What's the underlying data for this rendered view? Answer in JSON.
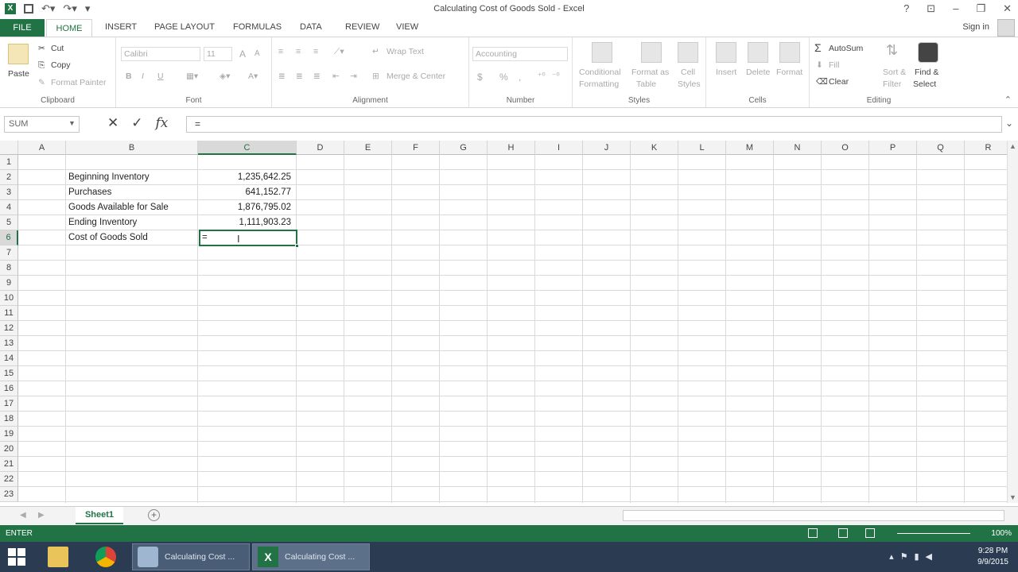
{
  "window": {
    "title": "Calculating Cost of Goods Sold - Excel",
    "signin": "Sign in",
    "qat": [
      "excel-logo-icon",
      "save-icon",
      "undo-icon",
      "redo-icon",
      "customize-icon"
    ],
    "controls": [
      "?",
      "restore",
      "minimize",
      "maximize",
      "close"
    ]
  },
  "ribbon_tabs": [
    "FILE",
    "HOME",
    "INSERT",
    "PAGE LAYOUT",
    "FORMULAS",
    "DATA",
    "REVIEW",
    "VIEW"
  ],
  "ribbon": {
    "clipboard": {
      "label": "Clipboard",
      "paste": "Paste",
      "cut": "Cut",
      "copy": "Copy",
      "format_painter": "Format Painter"
    },
    "font": {
      "label": "Font",
      "font_name": "Calibri",
      "font_size": "11",
      "bold": "B",
      "italic": "I",
      "underline": "U",
      "grow": "A",
      "shrink": "A"
    },
    "alignment": {
      "label": "Alignment",
      "wrap_text": "Wrap Text",
      "merge_center": "Merge & Center"
    },
    "number": {
      "label": "Number",
      "format": "Accounting",
      "currency": "$",
      "percent": "%",
      "comma": ","
    },
    "styles": {
      "label": "Styles",
      "conditional": "Conditional",
      "conditional2": "Formatting",
      "format_as": "Format as",
      "format_as2": "Table",
      "cell": "Cell",
      "cell2": "Styles"
    },
    "cells": {
      "label": "Cells",
      "insert": "Insert",
      "delete": "Delete",
      "format": "Format"
    },
    "editing": {
      "label": "Editing",
      "autosum": "AutoSum",
      "fill": "Fill",
      "clear": "Clear",
      "sort": "Sort &",
      "sort2": "Filter",
      "find": "Find &",
      "find2": "Select"
    }
  },
  "formula_bar": {
    "name_box": "SUM",
    "cancel": "✕",
    "enter": "✓",
    "fx": "fx",
    "content": "="
  },
  "columns": [
    "A",
    "B",
    "C",
    "D",
    "E",
    "F",
    "G",
    "H",
    "I",
    "J",
    "K",
    "L",
    "M",
    "N",
    "O",
    "P",
    "Q",
    "R"
  ],
  "rows": [
    "1",
    "2",
    "3",
    "4",
    "5",
    "6",
    "7",
    "8",
    "9",
    "10",
    "11",
    "12",
    "13",
    "14",
    "15",
    "16",
    "17",
    "18",
    "19",
    "20",
    "21",
    "22",
    "23"
  ],
  "cells": {
    "b2": "Beginning Inventory",
    "c2": "1,235,642.25",
    "b3": "Purchases",
    "c3": "641,152.77",
    "b4": "Goods Available for Sale",
    "c4": "1,876,795.02",
    "b5": "Ending Inventory",
    "c5": "1,111,903.23",
    "b6": "Cost of Goods Sold",
    "c6": "="
  },
  "active_cell": "C6",
  "sheet_tabs": [
    "Sheet1"
  ],
  "status": {
    "mode": "ENTER",
    "zoom": "100%"
  },
  "taskbar": {
    "items": [
      {
        "name": "start-icon"
      },
      {
        "name": "file-explorer-icon"
      },
      {
        "name": "chrome-icon"
      },
      {
        "label": "Calculating Cost ..."
      },
      {
        "label": "Calculating Cost ..."
      }
    ],
    "time": "9:28 PM",
    "date": "9/9/2015"
  },
  "colors": {
    "accent": "#217346",
    "taskbar": "#2a3b52"
  }
}
